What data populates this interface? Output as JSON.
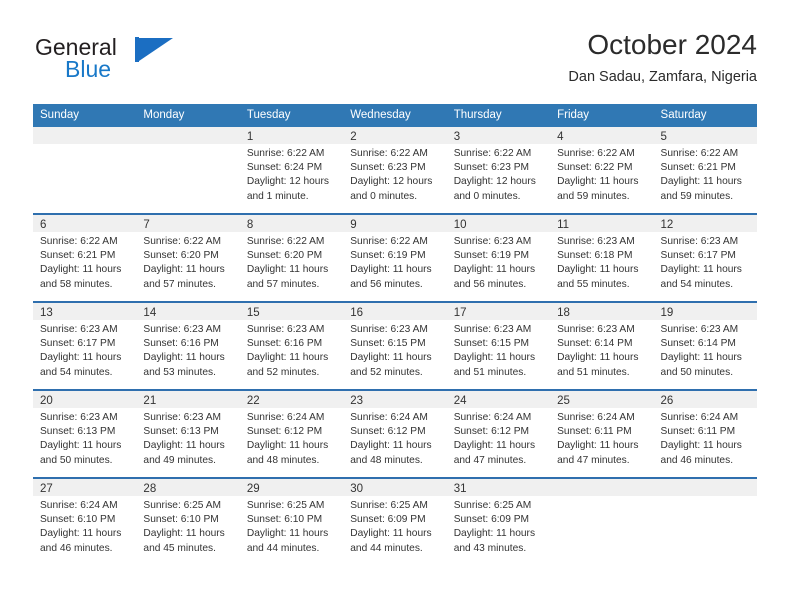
{
  "brand": {
    "word_one": "General",
    "word_two": "Blue",
    "mark": "flag-triangle-logo"
  },
  "header": {
    "title": "October 2024",
    "subtitle": "Dan Sadau, Zamfara, Nigeria"
  },
  "colors": {
    "header_blue": "#3078b4",
    "row_separator": "#2f6fae",
    "date_band": "#f0f0f0",
    "brand_blue": "#1878c8",
    "text": "#333333"
  },
  "weekdays": [
    "Sunday",
    "Monday",
    "Tuesday",
    "Wednesday",
    "Thursday",
    "Friday",
    "Saturday"
  ],
  "weeks": [
    [
      {
        "day": "",
        "sunrise": "",
        "sunset": "",
        "daylight_line1": "",
        "daylight_line2": ""
      },
      {
        "day": "",
        "sunrise": "",
        "sunset": "",
        "daylight_line1": "",
        "daylight_line2": ""
      },
      {
        "day": "1",
        "sunrise": "Sunrise: 6:22 AM",
        "sunset": "Sunset: 6:24 PM",
        "daylight_line1": "Daylight: 12 hours",
        "daylight_line2": "and 1 minute."
      },
      {
        "day": "2",
        "sunrise": "Sunrise: 6:22 AM",
        "sunset": "Sunset: 6:23 PM",
        "daylight_line1": "Daylight: 12 hours",
        "daylight_line2": "and 0 minutes."
      },
      {
        "day": "3",
        "sunrise": "Sunrise: 6:22 AM",
        "sunset": "Sunset: 6:23 PM",
        "daylight_line1": "Daylight: 12 hours",
        "daylight_line2": "and 0 minutes."
      },
      {
        "day": "4",
        "sunrise": "Sunrise: 6:22 AM",
        "sunset": "Sunset: 6:22 PM",
        "daylight_line1": "Daylight: 11 hours",
        "daylight_line2": "and 59 minutes."
      },
      {
        "day": "5",
        "sunrise": "Sunrise: 6:22 AM",
        "sunset": "Sunset: 6:21 PM",
        "daylight_line1": "Daylight: 11 hours",
        "daylight_line2": "and 59 minutes."
      }
    ],
    [
      {
        "day": "6",
        "sunrise": "Sunrise: 6:22 AM",
        "sunset": "Sunset: 6:21 PM",
        "daylight_line1": "Daylight: 11 hours",
        "daylight_line2": "and 58 minutes."
      },
      {
        "day": "7",
        "sunrise": "Sunrise: 6:22 AM",
        "sunset": "Sunset: 6:20 PM",
        "daylight_line1": "Daylight: 11 hours",
        "daylight_line2": "and 57 minutes."
      },
      {
        "day": "8",
        "sunrise": "Sunrise: 6:22 AM",
        "sunset": "Sunset: 6:20 PM",
        "daylight_line1": "Daylight: 11 hours",
        "daylight_line2": "and 57 minutes."
      },
      {
        "day": "9",
        "sunrise": "Sunrise: 6:22 AM",
        "sunset": "Sunset: 6:19 PM",
        "daylight_line1": "Daylight: 11 hours",
        "daylight_line2": "and 56 minutes."
      },
      {
        "day": "10",
        "sunrise": "Sunrise: 6:23 AM",
        "sunset": "Sunset: 6:19 PM",
        "daylight_line1": "Daylight: 11 hours",
        "daylight_line2": "and 56 minutes."
      },
      {
        "day": "11",
        "sunrise": "Sunrise: 6:23 AM",
        "sunset": "Sunset: 6:18 PM",
        "daylight_line1": "Daylight: 11 hours",
        "daylight_line2": "and 55 minutes."
      },
      {
        "day": "12",
        "sunrise": "Sunrise: 6:23 AM",
        "sunset": "Sunset: 6:17 PM",
        "daylight_line1": "Daylight: 11 hours",
        "daylight_line2": "and 54 minutes."
      }
    ],
    [
      {
        "day": "13",
        "sunrise": "Sunrise: 6:23 AM",
        "sunset": "Sunset: 6:17 PM",
        "daylight_line1": "Daylight: 11 hours",
        "daylight_line2": "and 54 minutes."
      },
      {
        "day": "14",
        "sunrise": "Sunrise: 6:23 AM",
        "sunset": "Sunset: 6:16 PM",
        "daylight_line1": "Daylight: 11 hours",
        "daylight_line2": "and 53 minutes."
      },
      {
        "day": "15",
        "sunrise": "Sunrise: 6:23 AM",
        "sunset": "Sunset: 6:16 PM",
        "daylight_line1": "Daylight: 11 hours",
        "daylight_line2": "and 52 minutes."
      },
      {
        "day": "16",
        "sunrise": "Sunrise: 6:23 AM",
        "sunset": "Sunset: 6:15 PM",
        "daylight_line1": "Daylight: 11 hours",
        "daylight_line2": "and 52 minutes."
      },
      {
        "day": "17",
        "sunrise": "Sunrise: 6:23 AM",
        "sunset": "Sunset: 6:15 PM",
        "daylight_line1": "Daylight: 11 hours",
        "daylight_line2": "and 51 minutes."
      },
      {
        "day": "18",
        "sunrise": "Sunrise: 6:23 AM",
        "sunset": "Sunset: 6:14 PM",
        "daylight_line1": "Daylight: 11 hours",
        "daylight_line2": "and 51 minutes."
      },
      {
        "day": "19",
        "sunrise": "Sunrise: 6:23 AM",
        "sunset": "Sunset: 6:14 PM",
        "daylight_line1": "Daylight: 11 hours",
        "daylight_line2": "and 50 minutes."
      }
    ],
    [
      {
        "day": "20",
        "sunrise": "Sunrise: 6:23 AM",
        "sunset": "Sunset: 6:13 PM",
        "daylight_line1": "Daylight: 11 hours",
        "daylight_line2": "and 50 minutes."
      },
      {
        "day": "21",
        "sunrise": "Sunrise: 6:23 AM",
        "sunset": "Sunset: 6:13 PM",
        "daylight_line1": "Daylight: 11 hours",
        "daylight_line2": "and 49 minutes."
      },
      {
        "day": "22",
        "sunrise": "Sunrise: 6:24 AM",
        "sunset": "Sunset: 6:12 PM",
        "daylight_line1": "Daylight: 11 hours",
        "daylight_line2": "and 48 minutes."
      },
      {
        "day": "23",
        "sunrise": "Sunrise: 6:24 AM",
        "sunset": "Sunset: 6:12 PM",
        "daylight_line1": "Daylight: 11 hours",
        "daylight_line2": "and 48 minutes."
      },
      {
        "day": "24",
        "sunrise": "Sunrise: 6:24 AM",
        "sunset": "Sunset: 6:12 PM",
        "daylight_line1": "Daylight: 11 hours",
        "daylight_line2": "and 47 minutes."
      },
      {
        "day": "25",
        "sunrise": "Sunrise: 6:24 AM",
        "sunset": "Sunset: 6:11 PM",
        "daylight_line1": "Daylight: 11 hours",
        "daylight_line2": "and 47 minutes."
      },
      {
        "day": "26",
        "sunrise": "Sunrise: 6:24 AM",
        "sunset": "Sunset: 6:11 PM",
        "daylight_line1": "Daylight: 11 hours",
        "daylight_line2": "and 46 minutes."
      }
    ],
    [
      {
        "day": "27",
        "sunrise": "Sunrise: 6:24 AM",
        "sunset": "Sunset: 6:10 PM",
        "daylight_line1": "Daylight: 11 hours",
        "daylight_line2": "and 46 minutes."
      },
      {
        "day": "28",
        "sunrise": "Sunrise: 6:25 AM",
        "sunset": "Sunset: 6:10 PM",
        "daylight_line1": "Daylight: 11 hours",
        "daylight_line2": "and 45 minutes."
      },
      {
        "day": "29",
        "sunrise": "Sunrise: 6:25 AM",
        "sunset": "Sunset: 6:10 PM",
        "daylight_line1": "Daylight: 11 hours",
        "daylight_line2": "and 44 minutes."
      },
      {
        "day": "30",
        "sunrise": "Sunrise: 6:25 AM",
        "sunset": "Sunset: 6:09 PM",
        "daylight_line1": "Daylight: 11 hours",
        "daylight_line2": "and 44 minutes."
      },
      {
        "day": "31",
        "sunrise": "Sunrise: 6:25 AM",
        "sunset": "Sunset: 6:09 PM",
        "daylight_line1": "Daylight: 11 hours",
        "daylight_line2": "and 43 minutes."
      },
      {
        "day": "",
        "sunrise": "",
        "sunset": "",
        "daylight_line1": "",
        "daylight_line2": ""
      },
      {
        "day": "",
        "sunrise": "",
        "sunset": "",
        "daylight_line1": "",
        "daylight_line2": ""
      }
    ]
  ]
}
